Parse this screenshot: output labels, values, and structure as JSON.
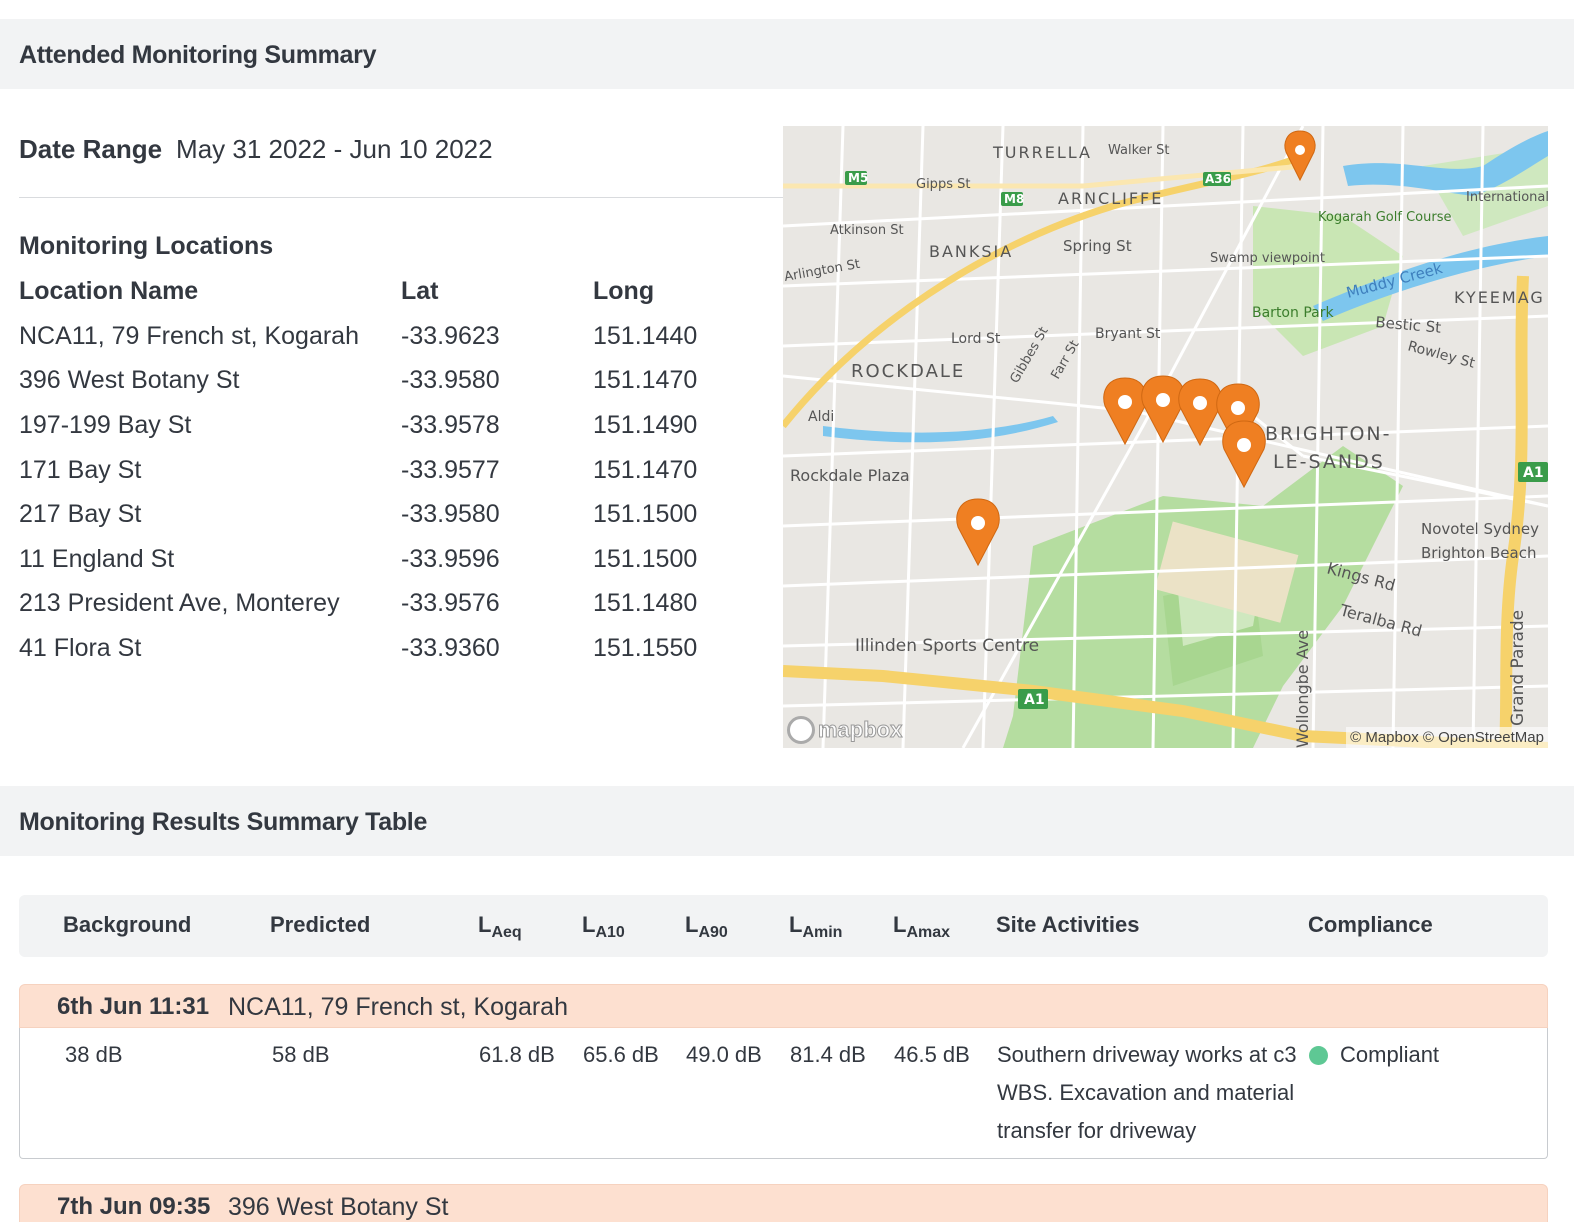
{
  "summary": {
    "title": "Attended Monitoring Summary",
    "date_range_label": "Date Range",
    "date_range_value": "May 31 2022 - Jun 10 2022",
    "locations_title": "Monitoring Locations",
    "columns": [
      "Location Name",
      "Lat",
      "Long"
    ],
    "locations": [
      {
        "name": "NCA11, 79 French st, Kogarah",
        "lat": "-33.9623",
        "long": "151.1440"
      },
      {
        "name": "396 West Botany St",
        "lat": "-33.9580",
        "long": "151.1470"
      },
      {
        "name": "197-199 Bay St",
        "lat": "-33.9578",
        "long": "151.1490"
      },
      {
        "name": "171 Bay St",
        "lat": "-33.9577",
        "long": "151.1470"
      },
      {
        "name": "217 Bay St",
        "lat": "-33.9580",
        "long": "151.1500"
      },
      {
        "name": "11 England St",
        "lat": "-33.9596",
        "long": "151.1500"
      },
      {
        "name": "213 President Ave, Monterey",
        "lat": "-33.9576",
        "long": "151.1480"
      },
      {
        "name": "41 Flora St",
        "lat": "-33.9360",
        "long": "151.1550"
      }
    ]
  },
  "map": {
    "logo": "mapbox",
    "attribution": "© Mapbox © OpenStreetMap",
    "labels": {
      "turrella": "TURRELLA",
      "arncliffe": "ARNCLIFFE",
      "banksia": "BANKSIA",
      "rockdale": "ROCKDALE",
      "brighton1": "BRIGHTON-",
      "brighton2": "LE-SANDS",
      "kyeemagh": "KYEEMAG",
      "walker": "Walker St",
      "gipps": "Gipps St",
      "atkinson": "Atkinson St",
      "spring": "Spring St",
      "arlington": "Arlington St",
      "swamp": "Swamp viewpoint",
      "barton": "Barton Park",
      "muddy": "Muddy Creek",
      "kogarah_golf": "Kogarah Golf Course",
      "international": "International",
      "bestic": "Bestic St",
      "rowley": "Rowley St",
      "lord": "Lord St",
      "bryant": "Bryant St",
      "gibbes": "Gibbes St",
      "farr": "Farr St",
      "aldi": "Aldi",
      "rockdale_plaza": "Rockdale Plaza",
      "novotel1": "Novotel Sydney",
      "novotel2": "Brighton Beach",
      "kings": "Kings Rd",
      "teralba": "Teralba Rd",
      "illinden": "Illinden Sports Centre",
      "parade": "Grand Parade",
      "coombe": "Wollongbe Ave",
      "a1": "A1",
      "m5": "M5",
      "m8": "M8",
      "a36": "A36"
    }
  },
  "results": {
    "title": "Monitoring Results Summary Table",
    "columns": {
      "background": "Background",
      "predicted": "Predicted",
      "laeq_base": "L",
      "laeq_sub": "Aeq",
      "la10_base": "L",
      "la10_sub": "A10",
      "la90_base": "L",
      "la90_sub": "A90",
      "lamin_base": "L",
      "lamin_sub": "Amin",
      "lamax_base": "L",
      "lamax_sub": "Amax",
      "activities": "Site Activities",
      "compliance": "Compliance"
    },
    "records": [
      {
        "time": "6th Jun 11:31",
        "location": "NCA11, 79 French st, Kogarah",
        "background": "38 dB",
        "predicted": "58 dB",
        "laeq": "61.8 dB",
        "la10": "65.6 dB",
        "la90": "49.0 dB",
        "lamin": "81.4 dB",
        "lamax": "46.5 dB",
        "activities": "Southern driveway works at c3 WBS. Excavation and material transfer for driveway",
        "compliance": "Compliant",
        "compliance_color": "#5ec894"
      },
      {
        "time": "7th Jun 09:35",
        "location": "396 West Botany St"
      }
    ]
  }
}
